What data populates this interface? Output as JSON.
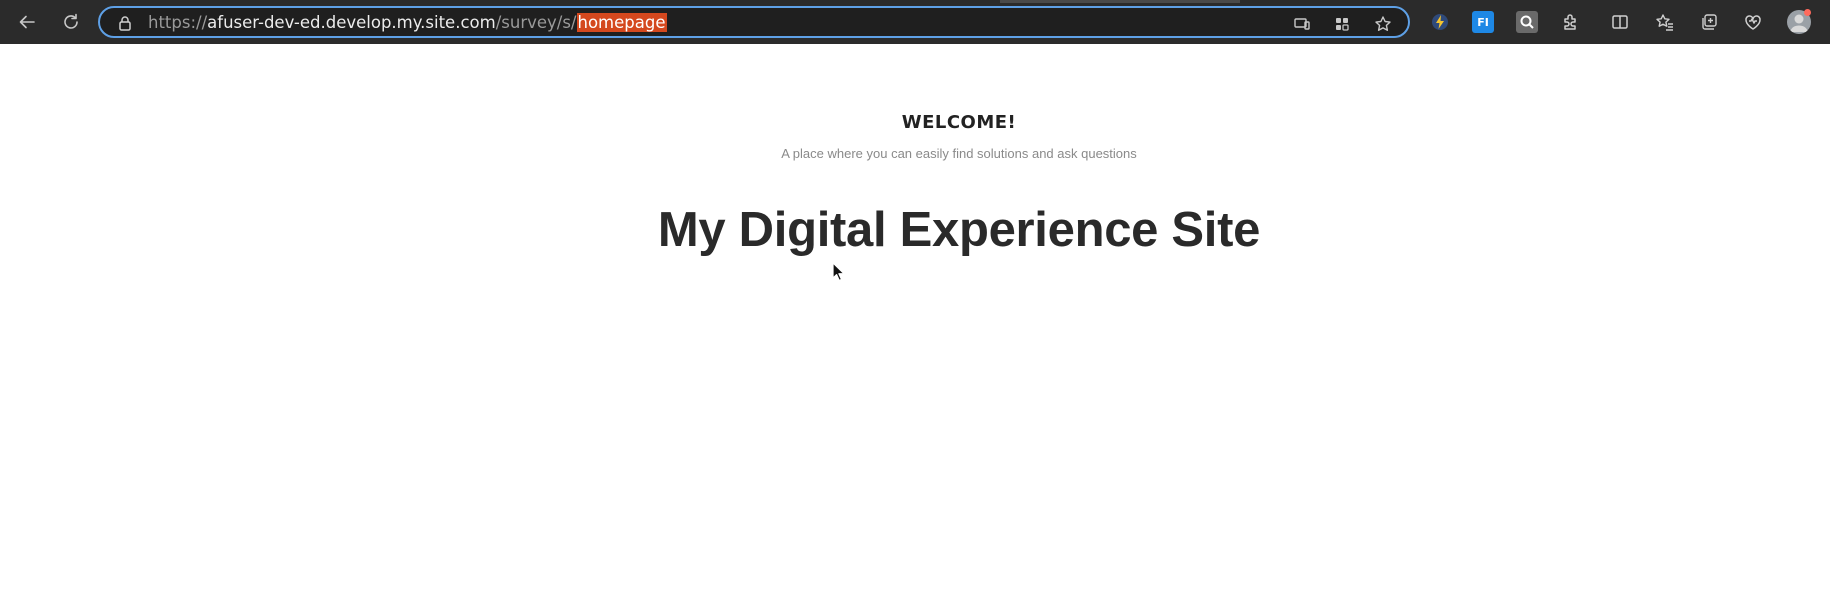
{
  "browser": {
    "url_prefix": "https://",
    "url_host": "afuser-dev-ed.develop.my.site.com",
    "url_path": "/survey/s/",
    "url_selected": "homepage",
    "address_icons": [
      "screen-cast-icon",
      "app-grid-icon",
      "favorite-star-icon"
    ],
    "extension_icons": [
      "lightning-extension-icon",
      "fi-extension-icon",
      "search-extension-icon",
      "puzzle-extensions-icon",
      "split-screen-icon",
      "favorites-icon",
      "collections-icon",
      "browser-essentials-icon"
    ],
    "fi_label": "FI"
  },
  "page": {
    "welcome": "WELCOME!",
    "tagline": "A place where you can easily find solutions and ask questions",
    "title": "My Digital Experience Site"
  }
}
